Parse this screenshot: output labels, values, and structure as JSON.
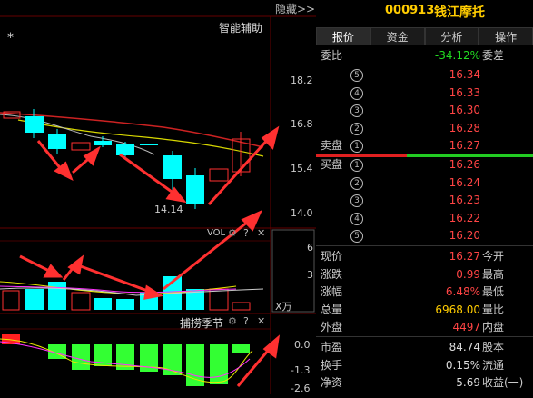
{
  "header": {
    "hide_label": "隐藏>>",
    "stock_code": "000913",
    "stock_name": "钱江摩托"
  },
  "main_chart": {
    "indicator_label": "智能辅助",
    "star": "*",
    "price_axis": [
      "18.2",
      "16.8",
      "15.4",
      "14.0"
    ],
    "low_label": "14.14",
    "colors": {
      "up": "#ff2020",
      "down": "#00ffff",
      "ma_yellow": "#e8e800",
      "ma_red": "#cc2222"
    }
  },
  "vol_panel": {
    "title": "VOL",
    "axis": [
      "6",
      "3"
    ],
    "unit": "X万"
  },
  "cycle_panel": {
    "title": "捕捞季节",
    "axis": [
      "0.0",
      "-1.3",
      "-2.6"
    ]
  },
  "tabs": [
    "报价",
    "资金",
    "分析",
    "操作"
  ],
  "ratio_row": {
    "label": "委比",
    "value": "-34.12%",
    "right": "委差"
  },
  "sell_orders": [
    {
      "label": "",
      "num": "5",
      "price": "16.34"
    },
    {
      "label": "",
      "num": "4",
      "price": "16.33"
    },
    {
      "label": "",
      "num": "3",
      "price": "16.30"
    },
    {
      "label": "",
      "num": "2",
      "price": "16.28"
    },
    {
      "label": "卖盘",
      "num": "1",
      "price": "16.27"
    }
  ],
  "buy_orders": [
    {
      "label": "买盘",
      "num": "1",
      "price": "16.26"
    },
    {
      "label": "",
      "num": "2",
      "price": "16.24"
    },
    {
      "label": "",
      "num": "3",
      "price": "16.23"
    },
    {
      "label": "",
      "num": "4",
      "price": "16.22"
    },
    {
      "label": "",
      "num": "5",
      "price": "16.20"
    }
  ],
  "quote_rows": [
    {
      "label": "现价",
      "value": "16.27",
      "right": "今开",
      "cls": "red"
    },
    {
      "label": "涨跌",
      "value": "0.99",
      "right": "最高",
      "cls": "red"
    },
    {
      "label": "涨幅",
      "value": "6.48%",
      "right": "最低",
      "cls": "red"
    },
    {
      "label": "总量",
      "value": "6968.00",
      "right": "量比",
      "cls": "yel"
    },
    {
      "label": "外盘",
      "value": "4497",
      "right": "内盘",
      "cls": "red"
    }
  ],
  "fund_rows": [
    {
      "label": "市盈",
      "value": "84.74",
      "right": "股本"
    },
    {
      "label": "换手",
      "value": "0.15%",
      "right": "流通"
    },
    {
      "label": "净资",
      "value": "5.69",
      "right": "收益(一)"
    }
  ]
}
